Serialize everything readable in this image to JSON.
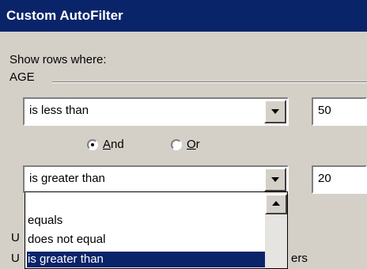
{
  "window": {
    "title": "Custom AutoFilter"
  },
  "dialog": {
    "show_rows_label": "Show rows where:",
    "field_name": "AGE",
    "criteria1": {
      "operator": "is less than",
      "value": "50"
    },
    "logic": {
      "and_label": "And",
      "or_label": "Or",
      "selected": "And"
    },
    "criteria2": {
      "operator": "is greater than",
      "value": "20"
    },
    "partial_hint_1": "U",
    "partial_hint_2": "U",
    "partial_hint_2_tail": "ers"
  },
  "dropdown_list": {
    "items": [
      "equals",
      "does not equal",
      "is greater than"
    ],
    "selected": "is greater than"
  }
}
